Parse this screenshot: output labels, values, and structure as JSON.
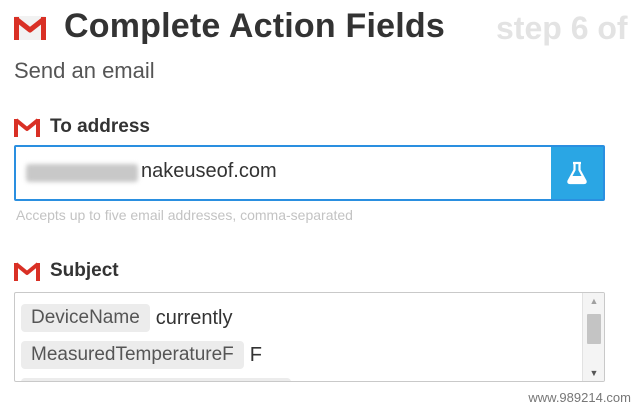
{
  "header": {
    "title": "Complete Action Fields",
    "step": "step 6 of"
  },
  "action": {
    "subtitle": "Send an email"
  },
  "to_field": {
    "label": "To address",
    "value": "nakeuseof.com",
    "helper": "Accepts up to five email addresses, comma-separated",
    "ingredient_icon": "flask-icon"
  },
  "subject_field": {
    "label": "Subject",
    "lines": [
      {
        "pill": "DeviceName",
        "text": "currently"
      },
      {
        "pill": "MeasuredTemperatureF",
        "text": "F"
      }
    ]
  },
  "colors": {
    "accent": "#2aa6e4",
    "focus_border": "#2a8fe0",
    "gmail_red": "#d93025"
  },
  "watermark": "www.989214.com"
}
